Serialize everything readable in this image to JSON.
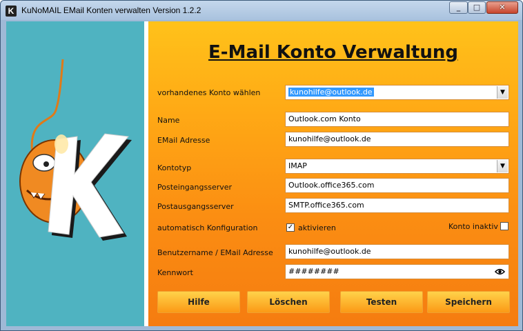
{
  "window": {
    "title": "KuNoMAIL EMail Konten verwalten Version 1.2.2",
    "icon_letter": "K",
    "controls": [
      "minimize-icon",
      "maximize-icon",
      "close-icon"
    ]
  },
  "page": {
    "title": "E-Mail Konto Verwaltung"
  },
  "form": {
    "account_select": {
      "label": "vorhandenes Konto wählen",
      "value": "kunohilfe@outlook.de"
    },
    "name": {
      "label": "Name",
      "value": "Outlook.com Konto"
    },
    "email": {
      "label": "EMail Adresse",
      "value": "kunohilfe@outlook.de"
    },
    "account_type": {
      "label": "Kontotyp",
      "value": "IMAP"
    },
    "incoming_server": {
      "label": "Posteingangsserver",
      "value": "Outlook.office365.com"
    },
    "outgoing_server": {
      "label": "Postausgangsserver",
      "value": "SMTP.office365.com"
    },
    "auto_config": {
      "label": "automatisch Konfiguration",
      "checkbox_label": "aktivieren",
      "checked": true
    },
    "inactive": {
      "label": "Konto inaktiv",
      "checked": false
    },
    "username": {
      "label": "Benutzername / EMail Adresse",
      "value": "kunohilfe@outlook.de"
    },
    "password": {
      "label": "Kennwort",
      "value": "########",
      "reveal_icon": "eye-icon"
    }
  },
  "buttons": {
    "help": "Hilfe",
    "delete": "Löschen",
    "test": "Testen",
    "save": "Speichern"
  },
  "colors": {
    "sidebar": "#4fb3c1",
    "panel_top": "#ffc21a",
    "panel_bottom": "#f57c10",
    "selection": "#3399ff"
  }
}
